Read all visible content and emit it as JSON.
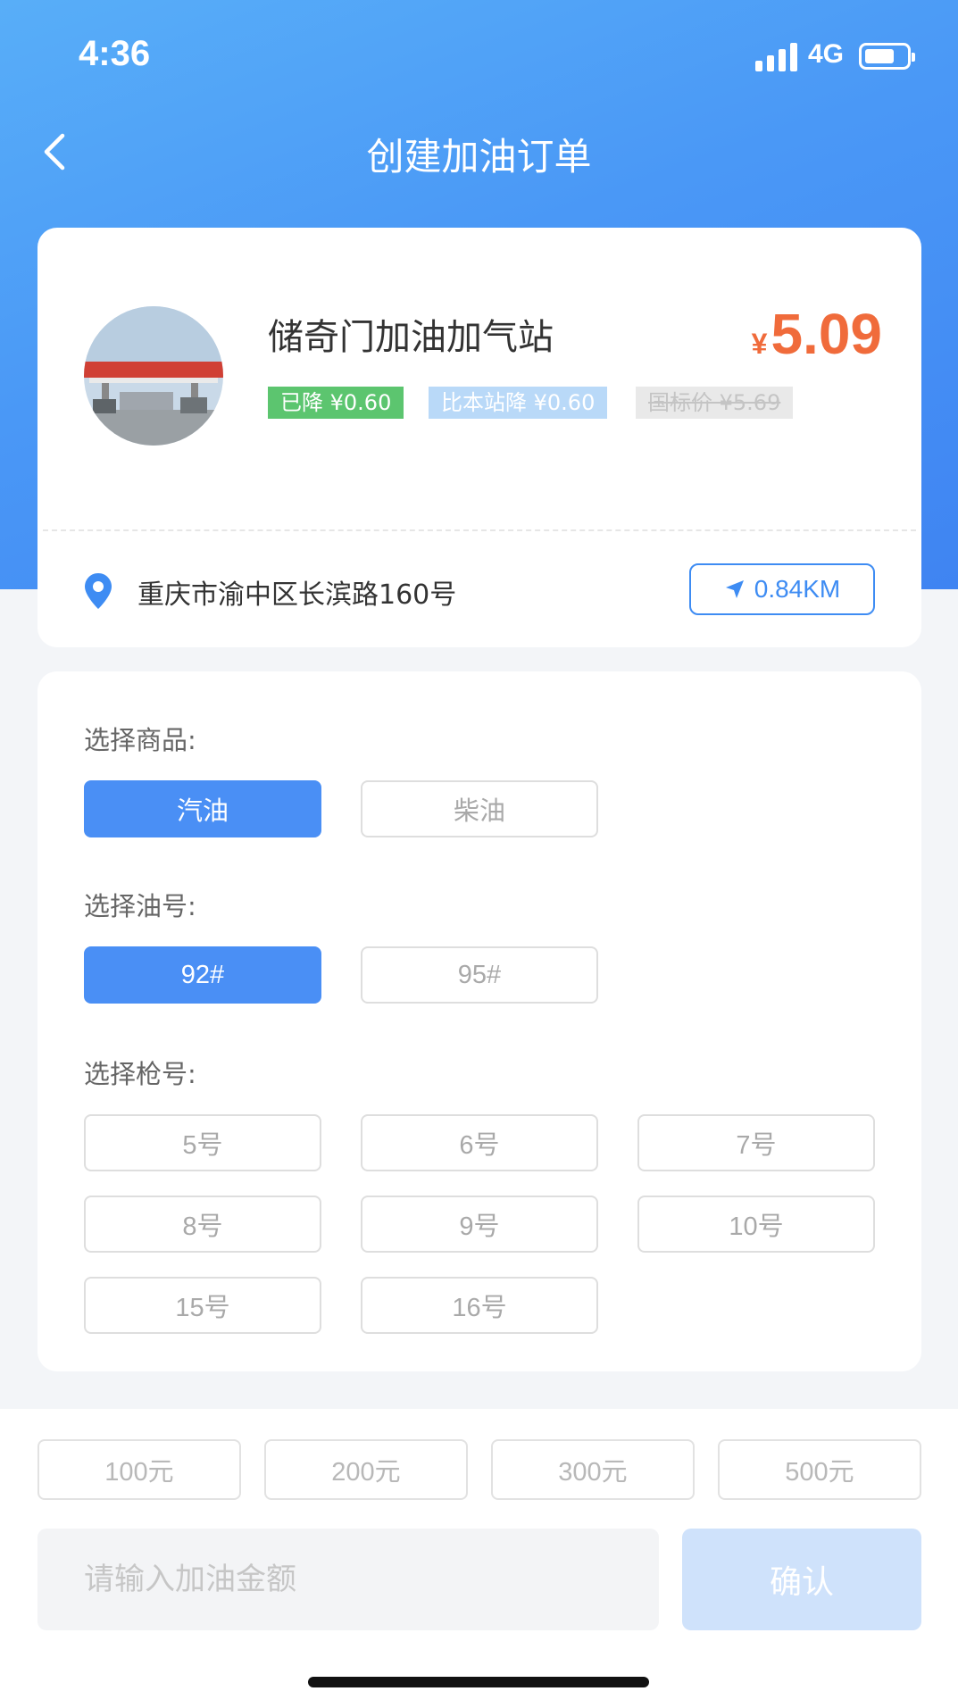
{
  "status_bar": {
    "time": "4:36",
    "network": "4G"
  },
  "nav": {
    "title": "创建加油订单"
  },
  "station": {
    "name": "储奇门加油加气站",
    "currency": "¥",
    "price": "5.09",
    "tags": {
      "discount": "已降 ¥0.60",
      "vs_station": "比本站降 ¥0.60",
      "national_price": "国标价 ¥5.69"
    },
    "address": "重庆市渝中区长滨路160号",
    "distance": "0.84KM"
  },
  "form": {
    "product_label": "选择商品:",
    "products": [
      {
        "label": "汽油",
        "selected": true
      },
      {
        "label": "柴油",
        "selected": false
      }
    ],
    "fuel_label": "选择油号:",
    "fuels": [
      {
        "label": "92#",
        "selected": true
      },
      {
        "label": "95#",
        "selected": false
      }
    ],
    "pump_label": "选择枪号:",
    "pumps": [
      "5号",
      "6号",
      "7号",
      "8号",
      "9号",
      "10号",
      "15号",
      "16号"
    ]
  },
  "amounts": [
    "100元",
    "200元",
    "300元",
    "500元"
  ],
  "amount_input": {
    "placeholder": "请输入加油金额"
  },
  "confirm_label": "确认",
  "colors": {
    "primary": "#4a8ff5",
    "price": "#f06b3b",
    "tag_green": "#5cc56f"
  }
}
